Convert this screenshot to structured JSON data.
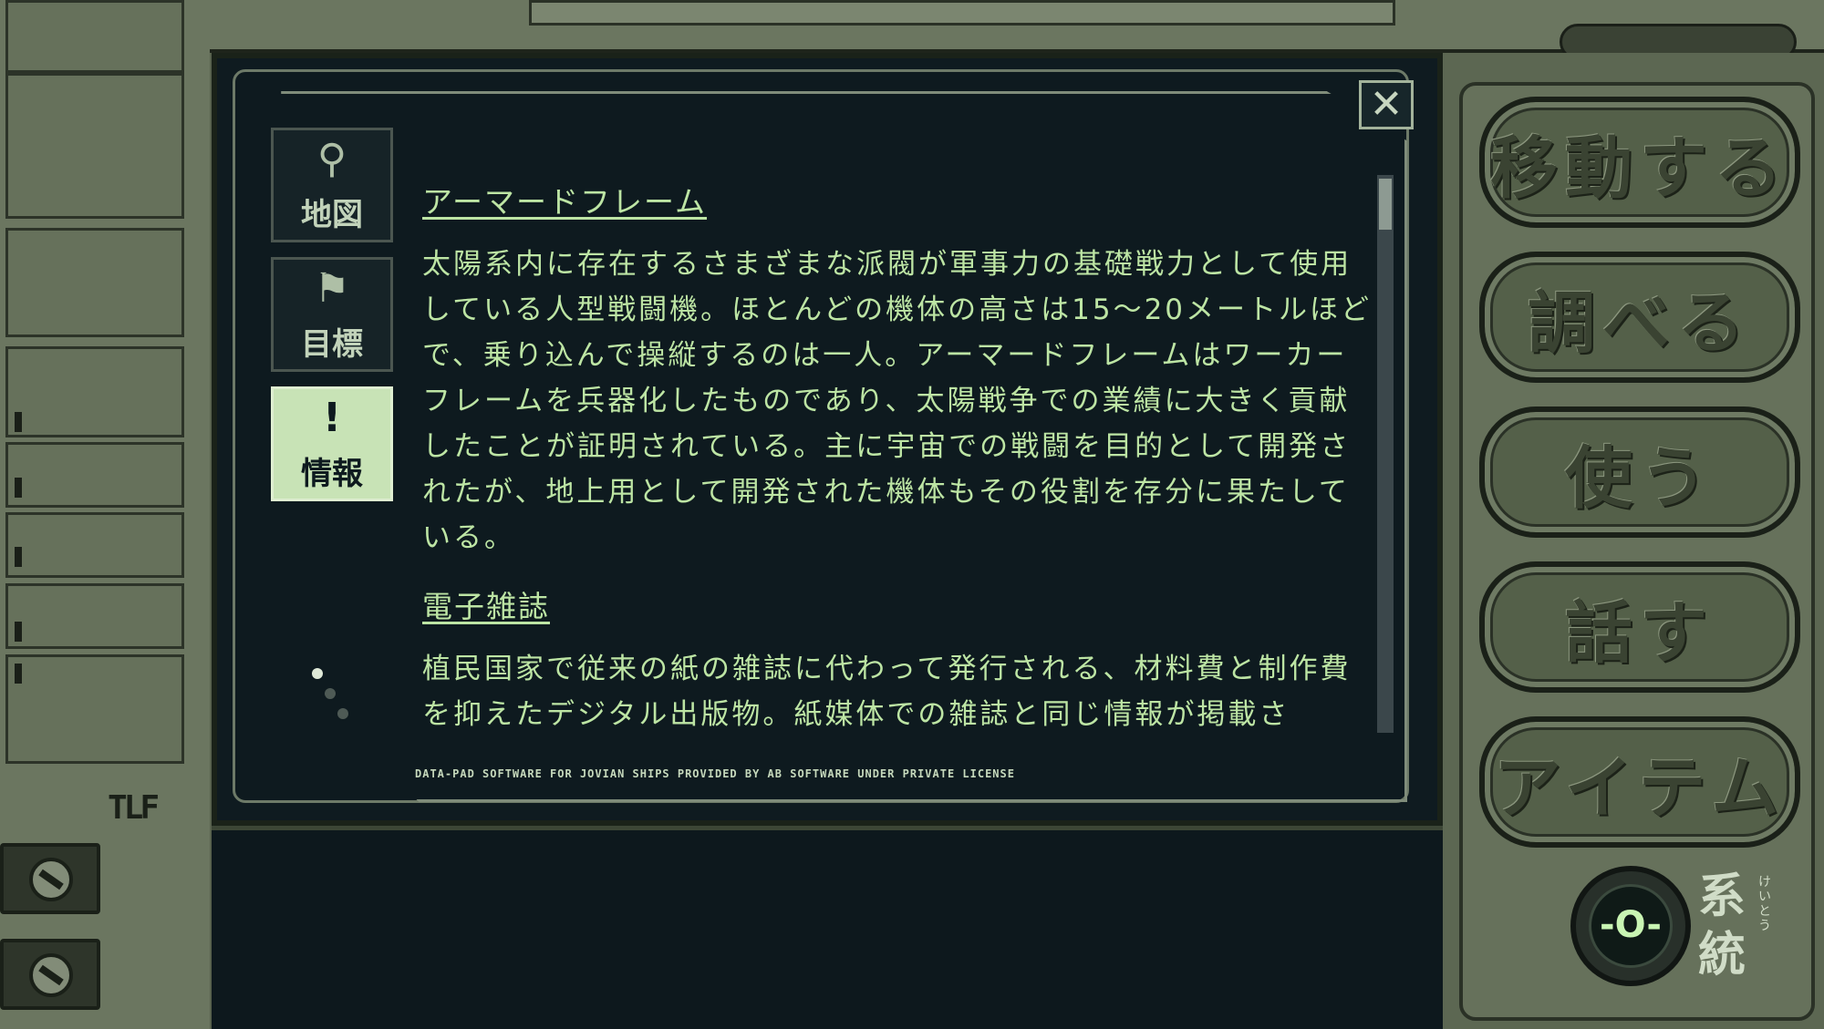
{
  "tabs": [
    {
      "label": "地図",
      "icon": "map-pin-icon",
      "glyph": "⚲",
      "active": false
    },
    {
      "label": "目標",
      "icon": "flag-icon",
      "glyph": "⚑",
      "active": false
    },
    {
      "label": "情報",
      "icon": "info-bubble-icon",
      "glyph": "!",
      "active": true
    }
  ],
  "close": {
    "glyph": "✕"
  },
  "entries": [
    {
      "title": "アーマードフレーム",
      "body": "太陽系内に存在するさまざまな派閥が軍事力の基礎戦力として使用している人型戦闘機。ほとんどの機体の高さは15～20メートルほどで、乗り込んで操縦するのは一人。アーマードフレームはワーカーフレームを兵器化したものであり、太陽戦争での業績に大きく貢献したことが証明されている。主に宇宙での戦闘を目的として開発されたが、地上用として開発された機体もその役割を存分に果たしている。"
    },
    {
      "title": "電子雑誌",
      "body": "植民国家で従来の紙の雑誌に代わって発行される、材料費と制作費を抑えたデジタル出版物。紙媒体での雑誌と同じ情報が掲載さ"
    }
  ],
  "footer": "DATA-PAD SOFTWARE FOR JOVIAN SHIPS PROVIDED BY AB SOFTWARE UNDER PRIVATE LICENSE",
  "commands": [
    "移動する",
    "調べる",
    "使う",
    "話す",
    "アイテム"
  ],
  "system": {
    "label_top": "系",
    "label_bottom": "統",
    "ruby": "けいとう",
    "knob_glyph": "-O-"
  },
  "logo": "TLF",
  "colors": {
    "text": "#bde5a4",
    "screen": "#0e1a1f",
    "active_tab": "#c8e3b6",
    "hull": "#66715b"
  }
}
